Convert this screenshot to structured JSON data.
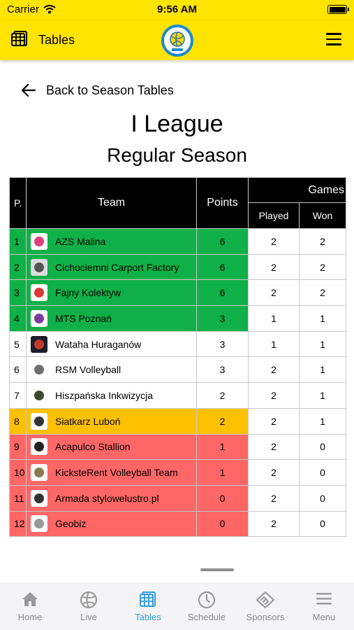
{
  "status_bar": {
    "carrier": "Carrier",
    "time": "9:56 AM"
  },
  "nav": {
    "title": "Tables",
    "icon": "table-grid-icon",
    "logo": "volleyball-league-logo"
  },
  "back_label": "Back to Season Tables",
  "league_title": "I League",
  "season_title": "Regular Season",
  "table": {
    "headers": {
      "position": "P.",
      "team": "Team",
      "points": "Points",
      "games": "Games",
      "played": "Played",
      "won": "Won"
    },
    "rows": [
      {
        "pos": "1",
        "team": "AZS Malina",
        "points": "6",
        "played": "2",
        "won": "2",
        "zone": "green",
        "logo_bg": "#ffffff",
        "logo_fg": "#e0407a"
      },
      {
        "pos": "2",
        "team": "Cichociemni Carport Factory",
        "points": "6",
        "played": "2",
        "won": "2",
        "zone": "green",
        "logo_bg": "#dcdcdc",
        "logo_fg": "#555555"
      },
      {
        "pos": "3",
        "team": "Fajny Kolektyw",
        "points": "6",
        "played": "2",
        "won": "2",
        "zone": "green",
        "logo_bg": "#ffffff",
        "logo_fg": "#d9383a"
      },
      {
        "pos": "4",
        "team": "MTS Poznań",
        "points": "3",
        "played": "1",
        "won": "1",
        "zone": "green",
        "logo_bg": "#ffffff",
        "logo_fg": "#7a3c9a"
      },
      {
        "pos": "5",
        "team": "Wataha Huraganów",
        "points": "3",
        "played": "1",
        "won": "1",
        "zone": "none",
        "logo_bg": "#1c1c2a",
        "logo_fg": "#c0392b"
      },
      {
        "pos": "6",
        "team": "RSM Volleyball",
        "points": "3",
        "played": "2",
        "won": "1",
        "zone": "none",
        "logo_bg": "#ffffff",
        "logo_fg": "#707070"
      },
      {
        "pos": "7",
        "team": "Hiszpańska Inkwizycja",
        "points": "2",
        "played": "2",
        "won": "1",
        "zone": "none",
        "logo_bg": "#ffffff",
        "logo_fg": "#3d4a2a"
      },
      {
        "pos": "8",
        "team": "Siatkarz Luboń",
        "points": "2",
        "played": "2",
        "won": "1",
        "zone": "orange",
        "logo_bg": "#ffffff",
        "logo_fg": "#333333"
      },
      {
        "pos": "9",
        "team": "Acapulco Stallion",
        "points": "1",
        "played": "2",
        "won": "0",
        "zone": "red",
        "logo_bg": "#ffffff",
        "logo_fg": "#222222"
      },
      {
        "pos": "10",
        "team": "KicksteRent Volleyball Team",
        "points": "1",
        "played": "2",
        "won": "0",
        "zone": "red",
        "logo_bg": "#ffffff",
        "logo_fg": "#8a7a50"
      },
      {
        "pos": "11",
        "team": "Armada stylowelustro.pl",
        "points": "0",
        "played": "2",
        "won": "0",
        "zone": "red",
        "logo_bg": "#ffffff",
        "logo_fg": "#333333"
      },
      {
        "pos": "12",
        "team": "Geobiz",
        "points": "0",
        "played": "2",
        "won": "0",
        "zone": "red",
        "logo_bg": "#ffffff",
        "logo_fg": "#999999"
      }
    ]
  },
  "tab_bar": {
    "tabs": [
      {
        "label": "Home",
        "icon": "home-icon",
        "active": false
      },
      {
        "label": "Live",
        "icon": "volleyball-icon",
        "active": false
      },
      {
        "label": "Tables",
        "icon": "table-grid-icon",
        "active": true
      },
      {
        "label": "Schedule",
        "icon": "clock-icon",
        "active": false
      },
      {
        "label": "Sponsors",
        "icon": "handshake-icon",
        "active": false
      },
      {
        "label": "Menu",
        "icon": "hamburger-menu-icon",
        "active": false
      }
    ]
  },
  "colors": {
    "brand_yellow": "#ffe400",
    "active_tab": "#2e9bdc",
    "zone_green": "#0fb047",
    "zone_orange": "#ffc000",
    "zone_red": "#ff6666"
  }
}
